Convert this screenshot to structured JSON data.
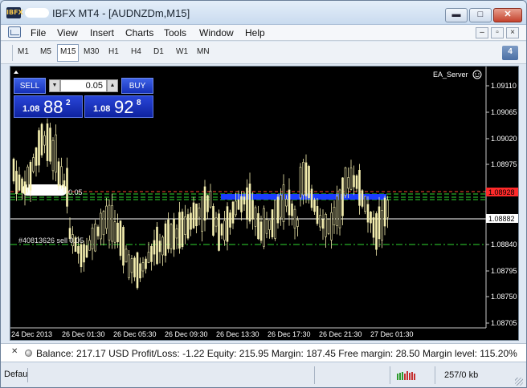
{
  "window": {
    "logo_text": "IBFX",
    "title": "IBFX MT4 - [AUDNZDm,M15]",
    "min_label": "▬",
    "max_label": "□",
    "close_label": "✕"
  },
  "menu": {
    "items": [
      "File",
      "View",
      "Insert",
      "Charts",
      "Tools",
      "Window",
      "Help"
    ],
    "mdi_buttons": [
      "–",
      "▫",
      "×"
    ]
  },
  "toolbar": {
    "timeframes": [
      "M1",
      "M5",
      "M15",
      "M30",
      "H1",
      "H4",
      "D1",
      "W1",
      "MN"
    ],
    "active": "M15",
    "notification_count": "4"
  },
  "trade_panel": {
    "sell_label": "SELL",
    "buy_label": "BUY",
    "lot_value": "0.05",
    "sell_price_small": "1.08",
    "sell_price_big": "88",
    "sell_price_sup": "2",
    "buy_price_small": "1.08",
    "buy_price_big": "92",
    "buy_price_sup": "8"
  },
  "chart": {
    "ea_label": "EA_Server",
    "price_labels": [
      "1.09110",
      "1.09065",
      "1.09020",
      "1.08975",
      "1.08928",
      "1.08882",
      "1.08840",
      "1.08795",
      "1.08750",
      "1.08705"
    ],
    "current_bid": "1.08882",
    "ask_marker": "1.08928",
    "time_labels": [
      "24 Dec 2013",
      "26 Dec 01:30",
      "26 Dec 05:30",
      "26 Dec 09:30",
      "26 Dec 13:30",
      "26 Dec 17:30",
      "26 Dec 21:30",
      "27 Dec 01:30"
    ],
    "order_label_1": "0.05",
    "order_label_2": "#40813626 sell 0.05",
    "colors": {
      "background": "#000000",
      "candles": "#f5efb0",
      "ask_line": "#ff4a30",
      "order_line": "#2fd82f",
      "bid_line": "#ffffff",
      "blue_band": "#1b3cff"
    }
  },
  "account": {
    "close_glyph": "✕",
    "summary": "Balance: 217.17 USD  Profit/Loss: -1.22  Equity: 215.95  Margin: 187.45  Free margin: 28.50  Margin level: 115.20%"
  },
  "status": {
    "left_text": "Default",
    "connection": "257/0 kb"
  }
}
